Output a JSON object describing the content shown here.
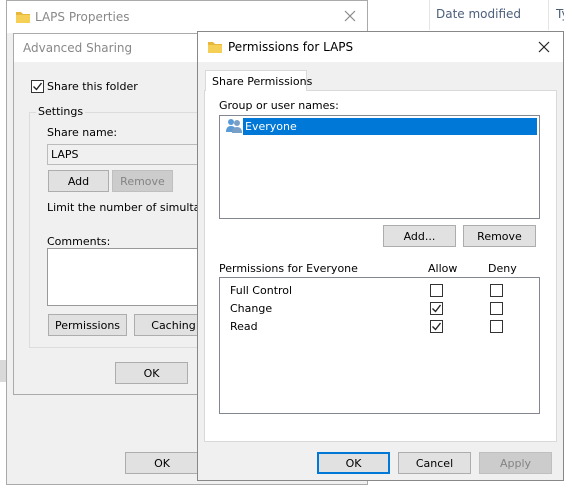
{
  "explorer": {
    "columns": [
      "Date modified",
      "Ty"
    ]
  },
  "laps_properties": {
    "title": "LAPS Properties",
    "ok_label": "OK"
  },
  "advanced_sharing": {
    "title": "Advanced Sharing",
    "share_label": "Share this folder",
    "share_checked": true,
    "settings_label": "Settings",
    "share_name_label": "Share name:",
    "share_name_value": "LAPS",
    "add_label": "Add",
    "remove_label": "Remove",
    "limit_label": "Limit the number of simultaneou",
    "comments_label": "Comments:",
    "permissions_label": "Permissions",
    "caching_label": "Caching",
    "ok_label": "OK"
  },
  "permissions": {
    "title": "Permissions for LAPS",
    "tab_label": "Share Permissions",
    "group_label": "Group or user names:",
    "users": [
      {
        "name": "Everyone",
        "icon": "users-icon",
        "selected": true
      }
    ],
    "add_label": "Add...",
    "remove_label": "Remove",
    "perm_header": "Permissions for Everyone",
    "allow_label": "Allow",
    "deny_label": "Deny",
    "rows": [
      {
        "label": "Full Control",
        "allow": false,
        "deny": false
      },
      {
        "label": "Change",
        "allow": true,
        "deny": false
      },
      {
        "label": "Read",
        "allow": true,
        "deny": false
      }
    ],
    "ok_label": "OK",
    "cancel_label": "Cancel",
    "apply_label": "Apply",
    "colors": {
      "selection": "#0078d7",
      "accent": "#0078d7"
    }
  }
}
